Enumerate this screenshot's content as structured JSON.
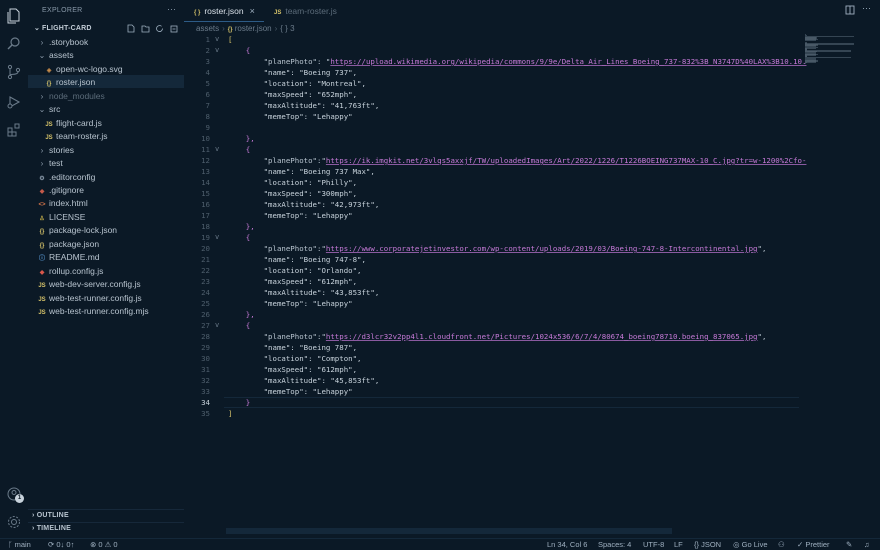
{
  "explorer": {
    "title": "EXPLORER",
    "more": "···",
    "folder": "FLIGHT-CARD",
    "items": [
      {
        "label": ".storybook",
        "kind": "folder-closed",
        "depth": 1
      },
      {
        "label": "assets",
        "kind": "folder-open",
        "depth": 1
      },
      {
        "label": "open-wc-logo.svg",
        "kind": "svg",
        "depth": 2
      },
      {
        "label": "roster.json",
        "kind": "json",
        "depth": 2,
        "selected": true
      },
      {
        "label": "node_modules",
        "kind": "folder-closed",
        "depth": 1,
        "dim": true
      },
      {
        "label": "src",
        "kind": "folder-open",
        "depth": 1
      },
      {
        "label": "flight-card.js",
        "kind": "js",
        "depth": 2
      },
      {
        "label": "team-roster.js",
        "kind": "js",
        "depth": 2
      },
      {
        "label": "stories",
        "kind": "folder-closed",
        "depth": 1
      },
      {
        "label": "test",
        "kind": "folder-closed",
        "depth": 1
      },
      {
        "label": ".editorconfig",
        "kind": "cfg",
        "depth": 1
      },
      {
        "label": ".gitignore",
        "kind": "git",
        "depth": 1
      },
      {
        "label": "index.html",
        "kind": "html",
        "depth": 1
      },
      {
        "label": "LICENSE",
        "kind": "lic",
        "depth": 1
      },
      {
        "label": "package-lock.json",
        "kind": "json",
        "depth": 1
      },
      {
        "label": "package.json",
        "kind": "json",
        "depth": 1
      },
      {
        "label": "README.md",
        "kind": "md",
        "depth": 1
      },
      {
        "label": "rollup.config.js",
        "kind": "rollup",
        "depth": 1
      },
      {
        "label": "web-dev-server.config.js",
        "kind": "js",
        "depth": 1
      },
      {
        "label": "web-test-runner.config.js",
        "kind": "js",
        "depth": 1
      },
      {
        "label": "web-test-runner.config.mjs",
        "kind": "js",
        "depth": 1
      }
    ],
    "outline": "OUTLINE",
    "timeline": "TIMELINE"
  },
  "tabs": [
    {
      "label": "roster.json",
      "icon": "{ }",
      "active": true
    },
    {
      "label": "team-roster.js",
      "icon": "JS",
      "active": false
    }
  ],
  "breadcrumb": {
    "folder": "assets",
    "file": "roster.json",
    "symbol": "{ } 3"
  },
  "code": {
    "current_line": 34,
    "lines": [
      {
        "n": 1,
        "fold": "v",
        "seg": [
          {
            "t": "[",
            "c": "brace"
          }
        ]
      },
      {
        "n": 2,
        "fold": "v",
        "seg": [
          {
            "t": "    {",
            "c": "brace2"
          }
        ]
      },
      {
        "n": 3,
        "seg": [
          {
            "t": "        \"planePhoto\": \"",
            "c": "key"
          },
          {
            "t": "https://upload.wikimedia.org/wikipedia/commons/9/9e/Delta_Air_Lines_Boeing_737-832%3B_N3747D%40LAX%3B10.10.",
            "c": "url"
          }
        ]
      },
      {
        "n": 4,
        "seg": [
          {
            "t": "        \"name\": \"Boeing 737\",",
            "c": "str"
          }
        ]
      },
      {
        "n": 5,
        "seg": [
          {
            "t": "        \"location\": \"Montreal\",",
            "c": "str"
          }
        ]
      },
      {
        "n": 6,
        "seg": [
          {
            "t": "        \"maxSpeed\": \"652mph\",",
            "c": "str"
          }
        ]
      },
      {
        "n": 7,
        "seg": [
          {
            "t": "        \"maxAltitude\": \"41,763ft\",",
            "c": "str"
          }
        ]
      },
      {
        "n": 8,
        "seg": [
          {
            "t": "        \"memeTop\": \"Lehappy\"",
            "c": "str"
          }
        ]
      },
      {
        "n": 9,
        "seg": []
      },
      {
        "n": 10,
        "seg": [
          {
            "t": "    },",
            "c": "brace2"
          }
        ]
      },
      {
        "n": 11,
        "fold": "v",
        "seg": [
          {
            "t": "    {",
            "c": "brace2"
          }
        ]
      },
      {
        "n": 12,
        "seg": [
          {
            "t": "        \"planePhoto\":\"",
            "c": "key"
          },
          {
            "t": "https://ik.imgkit.net/3vlqs5axxjf/TW/uploadedImages/Art/2022/1226/T1226BOEING737MAX-10_C.jpg?tr=w-1200%2Cfo-",
            "c": "url"
          }
        ]
      },
      {
        "n": 13,
        "seg": [
          {
            "t": "        \"name\": \"Boeing 737 Max\",",
            "c": "str"
          }
        ]
      },
      {
        "n": 14,
        "seg": [
          {
            "t": "        \"location\": \"Philly\",",
            "c": "str"
          }
        ]
      },
      {
        "n": 15,
        "seg": [
          {
            "t": "        \"maxSpeed\": \"300mph\",",
            "c": "str"
          }
        ]
      },
      {
        "n": 16,
        "seg": [
          {
            "t": "        \"maxAltitude\": \"42,973ft\",",
            "c": "str"
          }
        ]
      },
      {
        "n": 17,
        "seg": [
          {
            "t": "        \"memeTop\": \"Lehappy\"",
            "c": "str"
          }
        ]
      },
      {
        "n": 18,
        "seg": [
          {
            "t": "    },",
            "c": "brace2"
          }
        ]
      },
      {
        "n": 19,
        "fold": "v",
        "seg": [
          {
            "t": "    {",
            "c": "brace2"
          }
        ]
      },
      {
        "n": 20,
        "seg": [
          {
            "t": "        \"planePhoto\":\"",
            "c": "key"
          },
          {
            "t": "https://www.corporatejetinvestor.com/wp-content/uploads/2019/03/Boeing-747-8-Intercontinental.jpg",
            "c": "url"
          },
          {
            "t": "\",",
            "c": "punc"
          }
        ]
      },
      {
        "n": 21,
        "seg": [
          {
            "t": "        \"name\": \"Boeing 747-8\",",
            "c": "str"
          }
        ]
      },
      {
        "n": 22,
        "seg": [
          {
            "t": "        \"location\": \"Orlando\",",
            "c": "str"
          }
        ]
      },
      {
        "n": 23,
        "seg": [
          {
            "t": "        \"maxSpeed\": \"612mph\",",
            "c": "str"
          }
        ]
      },
      {
        "n": 24,
        "seg": [
          {
            "t": "        \"maxAltitude\": \"43,853ft\",",
            "c": "str"
          }
        ]
      },
      {
        "n": 25,
        "seg": [
          {
            "t": "        \"memeTop\": \"Lehappy\"",
            "c": "str"
          }
        ]
      },
      {
        "n": 26,
        "seg": [
          {
            "t": "    },",
            "c": "brace2"
          }
        ]
      },
      {
        "n": 27,
        "fold": "v",
        "seg": [
          {
            "t": "    {",
            "c": "brace2"
          }
        ]
      },
      {
        "n": 28,
        "seg": [
          {
            "t": "        \"planePhoto\":\"",
            "c": "key"
          },
          {
            "t": "https://d3lcr32v2pp4l1.cloudfront.net/Pictures/1024x536/6/7/4/80674_boeing78710.boeing_837065.jpg",
            "c": "url"
          },
          {
            "t": "\",",
            "c": "punc"
          }
        ]
      },
      {
        "n": 29,
        "seg": [
          {
            "t": "        \"name\": \"Boeing 787\",",
            "c": "str"
          }
        ]
      },
      {
        "n": 30,
        "seg": [
          {
            "t": "        \"location\": \"Compton\",",
            "c": "str"
          }
        ]
      },
      {
        "n": 31,
        "seg": [
          {
            "t": "        \"maxSpeed\": \"612mph\",",
            "c": "str"
          }
        ]
      },
      {
        "n": 32,
        "seg": [
          {
            "t": "        \"maxAltitude\": \"45,853ft\",",
            "c": "str"
          }
        ]
      },
      {
        "n": 33,
        "seg": [
          {
            "t": "        \"memeTop\": \"Lehappy\"",
            "c": "str"
          }
        ]
      },
      {
        "n": 34,
        "seg": [
          {
            "t": "    }",
            "c": "brace2"
          }
        ]
      },
      {
        "n": 35,
        "seg": [
          {
            "t": "]",
            "c": "brace"
          }
        ]
      }
    ]
  },
  "status": {
    "branch": "main",
    "sync": "0↓ 0↑",
    "problems": "⊗ 0 ⚠ 0",
    "position": "Ln 34, Col 6",
    "spaces": "Spaces: 4",
    "encoding": "UTF-8",
    "eol": "LF",
    "language": "{} JSON",
    "golive": "Go Live",
    "prettier": "✓ Prettier"
  },
  "accounts_badge": "1",
  "colors": {
    "background": "#0b1926",
    "url": "#c77ad8",
    "bracket": "#d8c56a"
  }
}
